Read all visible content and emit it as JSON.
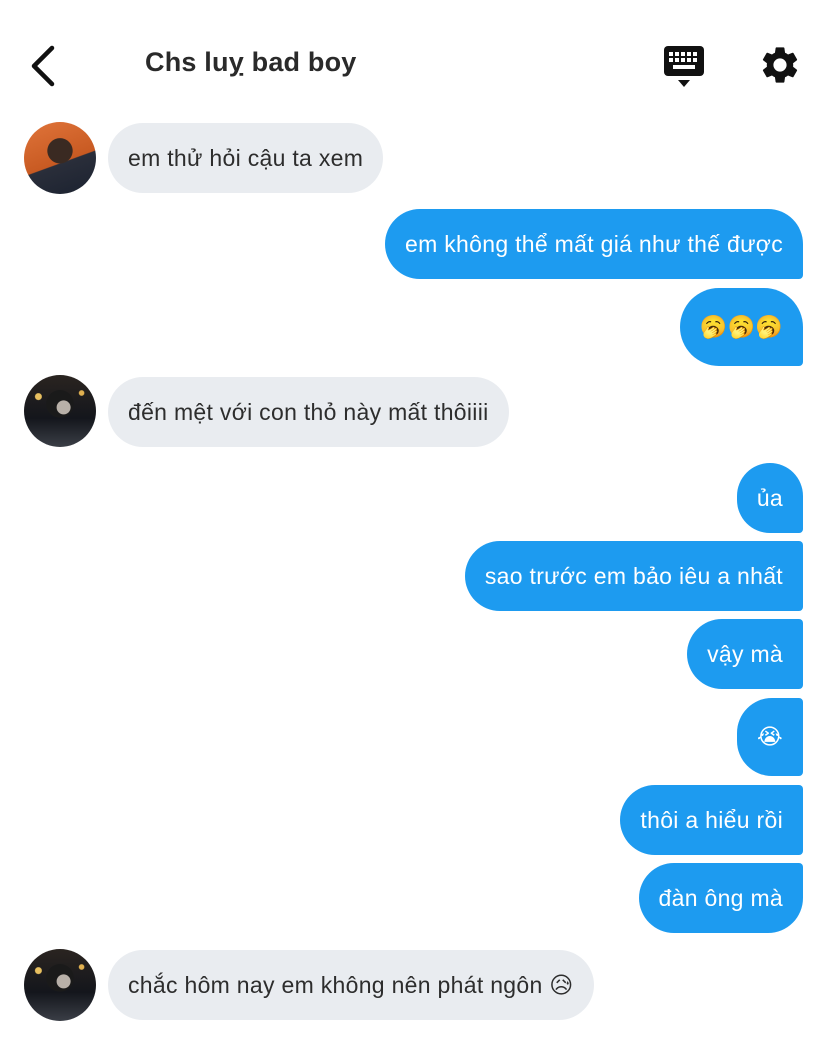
{
  "header": {
    "title": "Chs luỵ bad boy"
  },
  "messages": [
    {
      "side": "in",
      "text": "em thử hỏi cậu ta xem"
    },
    {
      "side": "out",
      "text": "em không thể mất giá như thế được"
    },
    {
      "side": "out",
      "text": "🥱🥱🥱"
    },
    {
      "side": "in",
      "text": "đến mệt với con thỏ này mất thôiiii"
    },
    {
      "side": "out",
      "text": "ủa"
    },
    {
      "side": "out",
      "text": "sao trước em bảo iêu a nhất"
    },
    {
      "side": "out",
      "text": "vậy mà"
    },
    {
      "side": "out",
      "text": "😭"
    },
    {
      "side": "out",
      "text": "thôi a hiểu rồi"
    },
    {
      "side": "out",
      "text": "đàn ông mà"
    },
    {
      "side": "in",
      "text": "chắc hôm nay em không nên phát ngôn 😥"
    }
  ],
  "colors": {
    "outgoing_bubble": "#1d9bf0",
    "incoming_bubble": "#e9ecf0"
  },
  "icons": [
    "back-arrow-icon",
    "keyboard-icon",
    "gear-icon"
  ]
}
